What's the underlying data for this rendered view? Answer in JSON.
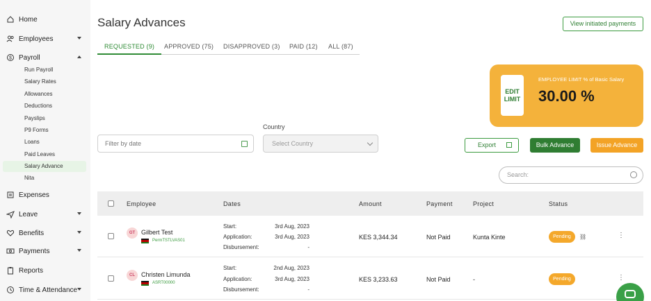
{
  "sidebar": {
    "items": [
      {
        "label": "Home",
        "icon": "home-icon"
      },
      {
        "label": "Employees",
        "icon": "users-icon"
      },
      {
        "label": "Payroll",
        "icon": "dollar-icon"
      },
      {
        "label": "Expenses",
        "icon": "receipt-icon"
      },
      {
        "label": "Leave",
        "icon": "plane-icon"
      },
      {
        "label": "Benefits",
        "icon": "heart-icon"
      },
      {
        "label": "Payments",
        "icon": "money-icon"
      },
      {
        "label": "Reports",
        "icon": "clipboard-icon"
      },
      {
        "label": "Time & Attendance",
        "icon": "clock-icon"
      }
    ],
    "payroll_sub": [
      "Run Payroll",
      "Salary Rates",
      "Allowances",
      "Deductions",
      "Payslips",
      "P9 Forms",
      "Loans",
      "Paid Leaves",
      "Salary Advance",
      "Nita"
    ],
    "active_sub": "Salary Advance"
  },
  "header": {
    "title": "Salary Advances",
    "view_initiated_label": "View initiated payments"
  },
  "tabs": [
    {
      "label": "REQUESTED (9)",
      "active": true
    },
    {
      "label": "APPROVED (75)",
      "active": false
    },
    {
      "label": "DISAPPROVED (3)",
      "active": false
    },
    {
      "label": "PAID (12)",
      "active": false
    },
    {
      "label": "ALL (87)",
      "active": false
    }
  ],
  "limit_card": {
    "button_line1": "EDIT",
    "button_line2": "LIMIT",
    "caption": "EMPLOYEE LIMIT % of Basic Salary",
    "value": "30.00 %",
    "color": "#f4b23b"
  },
  "filters": {
    "date_placeholder": "Filter by date",
    "country_label": "Country",
    "country_placeholder": "Select Country"
  },
  "actions": {
    "export_label": "Export",
    "bulk_label": "Bulk Advance",
    "issue_label": "Issue Advance"
  },
  "search": {
    "placeholder": "Search:"
  },
  "table": {
    "headers": [
      "Employee",
      "Dates",
      "Amount",
      "Payment",
      "Project",
      "Status"
    ],
    "date_labels": [
      "Start:",
      "Application:",
      "Disbursement:"
    ],
    "rows": [
      {
        "initials": "GT",
        "name": "Gilbert Test",
        "code": "PermTSTLVAS01",
        "start": "3rd Aug, 2023",
        "application": "3rd Aug, 2023",
        "disbursement": "-",
        "amount": "KES 3,344.34",
        "payment": "Not Paid",
        "project": "Kunta Kinte",
        "status": "Pending"
      },
      {
        "initials": "CL",
        "name": "Christen Limunda",
        "code": "ASRT00000",
        "start": "2nd Aug, 2023",
        "application": "3rd Aug, 2023",
        "disbursement": "-",
        "amount": "KES 3,233.63",
        "payment": "Not Paid",
        "project": "-",
        "status": "Pending"
      }
    ]
  },
  "colors": {
    "accent": "#2f8b35",
    "warning": "#f3a326"
  }
}
